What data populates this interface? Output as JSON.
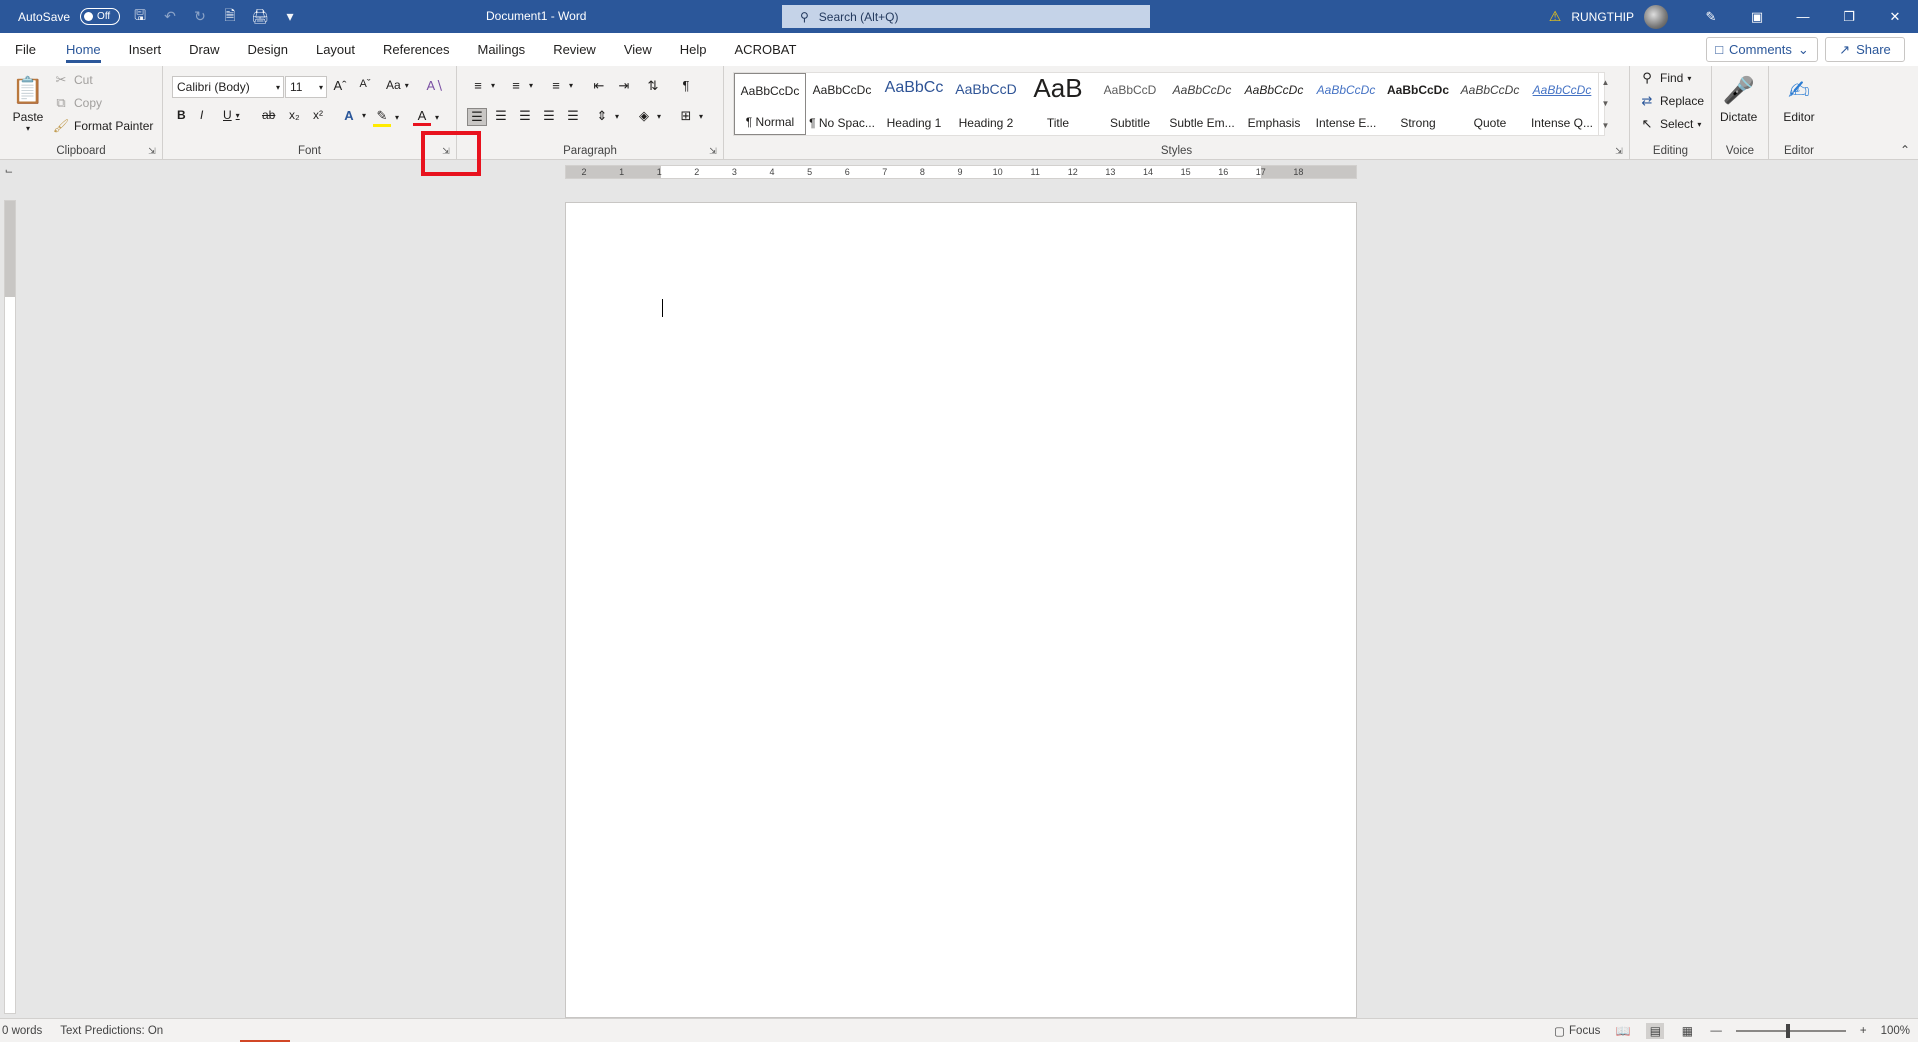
{
  "titlebar": {
    "autosave_label": "AutoSave",
    "autosave_state": "Off",
    "document_title": "Document1  -  Word",
    "search_placeholder": "Search (Alt+Q)",
    "username": "RUNGTHIP",
    "accent_color": "#2b579a"
  },
  "tabs": [
    "File",
    "Home",
    "Insert",
    "Draw",
    "Design",
    "Layout",
    "References",
    "Mailings",
    "Review",
    "View",
    "Help",
    "ACROBAT"
  ],
  "active_tab": "Home",
  "header_buttons": {
    "comments": "Comments",
    "share": "Share"
  },
  "clipboard": {
    "label": "Clipboard",
    "paste": "Paste",
    "cut": "Cut",
    "copy": "Copy",
    "format_painter": "Format Painter"
  },
  "font": {
    "label": "Font",
    "font_name": "Calibri (Body)",
    "font_size": "11",
    "bold": "B",
    "italic": "I",
    "underline": "U",
    "strike": "ab",
    "subscript": "x₂",
    "superscript": "x²",
    "change_case": "Aa"
  },
  "paragraph": {
    "label": "Paragraph"
  },
  "styles": {
    "label": "Styles",
    "items": [
      {
        "sample": "AaBbCcDc",
        "name": "¶ Normal"
      },
      {
        "sample": "AaBbCcDc",
        "name": "¶ No Spac..."
      },
      {
        "sample": "AaBbCc",
        "name": "Heading 1"
      },
      {
        "sample": "AaBbCcD",
        "name": "Heading 2"
      },
      {
        "sample": "AaB",
        "name": "Title"
      },
      {
        "sample": "AaBbCcD",
        "name": "Subtitle"
      },
      {
        "sample": "AaBbCcDc",
        "name": "Subtle Em..."
      },
      {
        "sample": "AaBbCcDc",
        "name": "Emphasis"
      },
      {
        "sample": "AaBbCcDc",
        "name": "Intense E..."
      },
      {
        "sample": "AaBbCcDc",
        "name": "Strong"
      },
      {
        "sample": "AaBbCcDc",
        "name": "Quote"
      },
      {
        "sample": "AaBbCcDc",
        "name": "Intense Q..."
      }
    ]
  },
  "editing": {
    "label": "Editing",
    "find": "Find",
    "replace": "Replace",
    "select": "Select"
  },
  "voice": {
    "label": "Voice",
    "dictate": "Dictate"
  },
  "editor": {
    "label": "Editor",
    "editor": "Editor"
  },
  "ruler_numbers": [
    "2",
    "1",
    "1",
    "2",
    "3",
    "4",
    "5",
    "6",
    "7",
    "8",
    "9",
    "10",
    "11",
    "12",
    "13",
    "14",
    "15",
    "16",
    "17",
    "18"
  ],
  "status": {
    "words": "0 words",
    "text_predictions": "Text Predictions: On",
    "focus": "Focus",
    "zoom": "100%"
  }
}
